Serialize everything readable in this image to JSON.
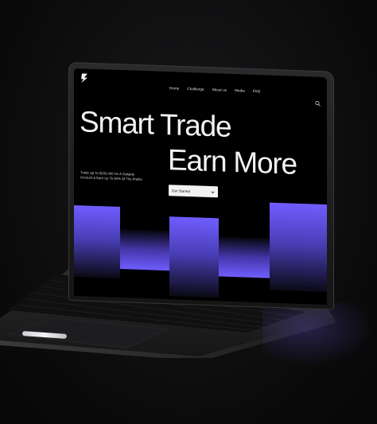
{
  "nav": {
    "items": [
      "Home",
      "Challenge",
      "About us",
      "Media",
      "FAQ"
    ]
  },
  "hero": {
    "line1": "Smart Trade",
    "line2": "Earn More"
  },
  "subtitle": "Trade Up To $200,000 On A Suitable Account & Earn Up To 90% Of The Profits",
  "cta": {
    "label": "Get Started"
  },
  "icons": {
    "logo": "brand-logo-icon",
    "search": "search-icon",
    "cta_arrow": "chevron-down-icon"
  },
  "colors": {
    "background": "#000000",
    "accent": "#6b5cff",
    "text": "#f2f2f2"
  }
}
